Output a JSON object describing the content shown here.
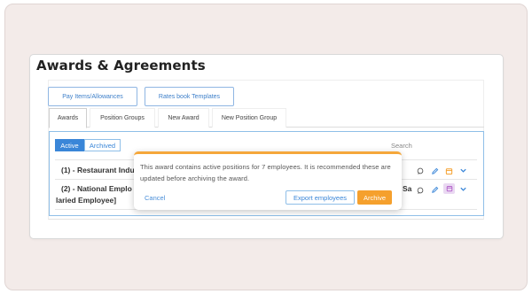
{
  "page": {
    "title": "Awards & Agreements"
  },
  "top_buttons": {
    "pay_items": "Pay Items/Allowances",
    "rates_book": "Rates book Templates"
  },
  "tabs": [
    {
      "label": "Awards",
      "active": true
    },
    {
      "label": "Position Groups",
      "active": false
    },
    {
      "label": "New Award",
      "active": false
    },
    {
      "label": "New Position Group",
      "active": false
    }
  ],
  "filter": {
    "active_label": "Active",
    "archived_label": "Archived",
    "search_label": "Search"
  },
  "rows": [
    {
      "text": "(1) - Restaurant Indu"
    },
    {
      "text_line1": "(2) - National Emplo",
      "text_line1_tail": "Sa",
      "text_line2": "laried Employee]"
    }
  ],
  "modal": {
    "message": "This award contains active positions for 7 employees. It is recommended these are updated before archiving the award.",
    "cancel_label": "Cancel",
    "export_label": "Export employees",
    "archive_label": "Archive"
  },
  "colors": {
    "accent_blue": "#3a86d8",
    "warning_orange": "#f5a02d",
    "background": "#f3ebe9"
  },
  "icons": [
    "copy-icon",
    "edit-icon",
    "archive-icon",
    "chevron-down-icon"
  ]
}
